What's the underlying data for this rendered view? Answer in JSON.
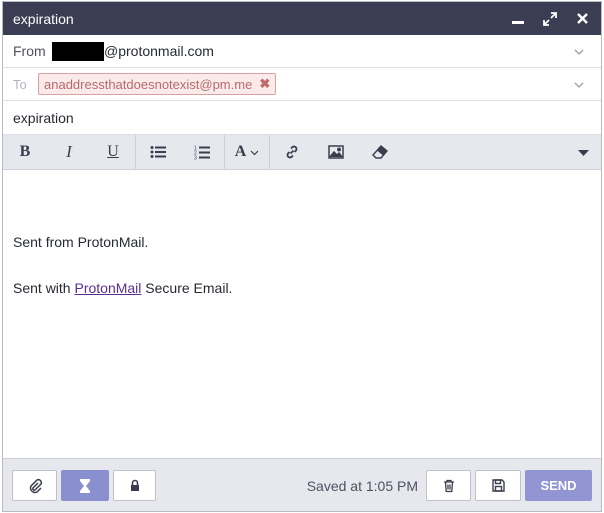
{
  "window": {
    "title": "expiration"
  },
  "from": {
    "label": "From",
    "address_suffix": "@protonmail.com"
  },
  "to": {
    "label": "To",
    "recipients": [
      {
        "address": "anaddressthatdoesnotexist@pm.me"
      }
    ]
  },
  "subject": {
    "value": "expiration"
  },
  "body": {
    "line1": "Sent from ProtonMail.",
    "line2_prefix": "Sent with ",
    "line2_link": "ProtonMail",
    "line2_suffix": " Secure Email."
  },
  "toolbar": {
    "bold": "B",
    "italic": "I",
    "underline": "U",
    "font": "A"
  },
  "footer": {
    "saved_text": "Saved at 1:05 PM",
    "send_label": "SEND"
  },
  "colors": {
    "titlebar": "#3b3d52",
    "accent": "#9196d3",
    "chip_border": "#d8a2a2",
    "link": "#5b2d91"
  }
}
